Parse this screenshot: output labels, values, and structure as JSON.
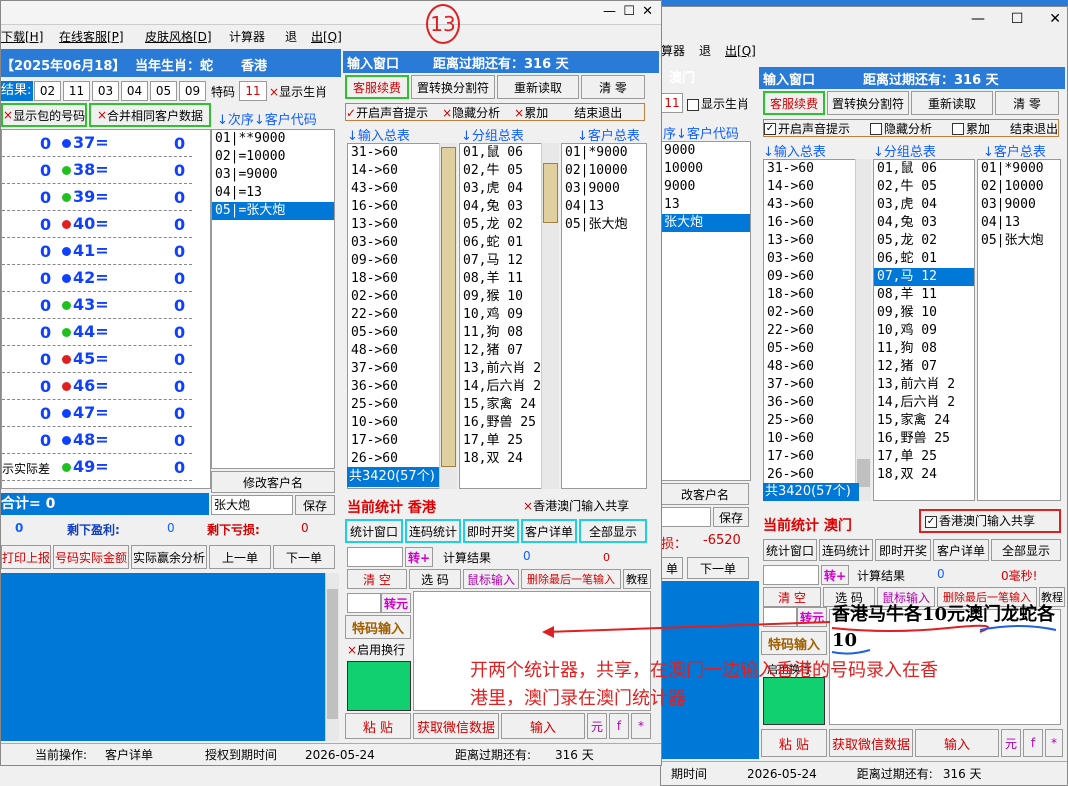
{
  "annotation": {
    "number": "13",
    "note_line1": "开两个统计器，共享，在澳门一边输入香港的号码录入在香",
    "note_line2": "港里，澳门录在澳门统计器",
    "handwritten": "香港马牛各10元澳门龙蛇各10"
  },
  "front": {
    "menu": [
      "下载[H]",
      "在线客服[P]",
      "皮肤风格[D]",
      "计算器",
      "退",
      "出[Q]"
    ],
    "date": "【2025年06月18】",
    "year_zodiac": "当年生肖：蛇",
    "region": "香港",
    "result_label": "结果:",
    "result_nums": [
      "02",
      "11",
      "03",
      "04",
      "05",
      "09"
    ],
    "special_label": "特码",
    "special": "11",
    "show_zodiac": "显示生肖",
    "show_pack": "显示包的号码",
    "merge_label": "合并相同客户数据",
    "left_rows": [
      {
        "a": "0",
        "n": "37=",
        "b": "0",
        "c": "#1040ff"
      },
      {
        "a": "0",
        "n": "38=",
        "b": "0",
        "c": "#20c020"
      },
      {
        "a": "0",
        "n": "39=",
        "b": "0",
        "c": "#20c020"
      },
      {
        "a": "0",
        "n": "40=",
        "b": "0",
        "c": "#e02020"
      },
      {
        "a": "0",
        "n": "41=",
        "b": "0",
        "c": "#1040ff"
      },
      {
        "a": "0",
        "n": "42=",
        "b": "0",
        "c": "#1040ff"
      },
      {
        "a": "0",
        "n": "43=",
        "b": "0",
        "c": "#20c020"
      },
      {
        "a": "0",
        "n": "44=",
        "b": "0",
        "c": "#20c020"
      },
      {
        "a": "0",
        "n": "45=",
        "b": "0",
        "c": "#e02020"
      },
      {
        "a": "0",
        "n": "46=",
        "b": "0",
        "c": "#e02020"
      },
      {
        "a": "0",
        "n": "47=",
        "b": "0",
        "c": "#1040ff"
      },
      {
        "a": "0",
        "n": "48=",
        "b": "0",
        "c": "#1040ff"
      }
    ],
    "last_row_label": "示实际差",
    "last_row_n": "49=",
    "last_row_b": "0",
    "order_hdr": "↓次序↓客户代码",
    "customers": [
      "01|**9000",
      "02|=10000",
      "03|=9000",
      "04|=13",
      "05|=张大炮"
    ],
    "edit_name": "修改客户名",
    "name_value": "张大炮",
    "save": "保存",
    "total": "合计= 0",
    "remaining_profit_label": "剩下盈利:",
    "remaining_profit": "0",
    "remaining_loss_label": "剩下亏损:",
    "remaining_loss": "0",
    "left_zero": "0",
    "btns": [
      "打印上报",
      "号码实际金额",
      "实际赢余分析",
      "上一单",
      "下一单"
    ],
    "input_window": "输入窗口",
    "expire": "距离过期还有：316 天",
    "top_btns": [
      "客服续费",
      "置转换分割符",
      "重新读取",
      "清 零"
    ],
    "checks": [
      "开启声音提示",
      "隐藏分析",
      "累加",
      "结束退出"
    ],
    "col_hdrs": [
      "↓输入总表",
      "↓分组总表",
      "↓客户总表"
    ],
    "input_list": [
      "31->60",
      "14->60",
      "43->60",
      "16->60",
      "13->60",
      "03->60",
      "09->60",
      "18->60",
      "02->60",
      "22->60",
      "05->60",
      "48->60",
      "37->60",
      "36->60",
      "25->60",
      "10->60",
      "17->60",
      "26->60"
    ],
    "input_total": "共3420(57个)",
    "group_list": [
      "01,鼠 06",
      "02,牛 05",
      "03,虎 04",
      "04,兔 03",
      "05,龙 02",
      "06,蛇 01",
      "07,马 12",
      "08,羊 11",
      "09,猴 10",
      "10,鸡 09",
      "11,狗 08",
      "12,猪 07",
      "13,前六肖 2",
      "14,后六肖 2",
      "15,家禽 24",
      "16,野兽 25",
      "17,单 25",
      "18,双 24"
    ],
    "cust_list": [
      "01|*9000",
      "02|10000",
      "03|9000",
      "04|13",
      "05|张大炮"
    ],
    "cur_stat": "当前统计 香港",
    "share": "香港澳门输入共享",
    "stat_btns": [
      "统计窗口",
      "连码统计",
      "即时开奖",
      "客户详单",
      "全部显示"
    ],
    "zhuan": "转+",
    "calc_result": "计算结果",
    "calc_a": "0",
    "calc_b": "0",
    "clear_row": [
      "清 空",
      "选 码",
      "鼠标输入",
      "删除最后一笔输入",
      "教程"
    ],
    "zhuanyuan": "转元",
    "special_input": "特码输入",
    "wrap": "启用换行",
    "bottom_btns": [
      "粘 贴",
      "获取微信数据",
      "输入",
      "元",
      "f",
      "*"
    ],
    "status": {
      "op_label": "当前操作:",
      "op": "客户详单",
      "auth": "授权到期时间",
      "date": "2026-05-24",
      "expire_label": "距离过期还有:",
      "days": "316 天"
    }
  },
  "back": {
    "menu": [
      "算器",
      "退",
      "出[Q]"
    ],
    "region": "澳门",
    "special": "11",
    "show_zodiac": "显示生肖",
    "order_hdr": "序↓客户代码",
    "customers": [
      "9000",
      "10000",
      "9000",
      "13",
      "张大炮"
    ],
    "edit_name": "改客户名",
    "save": "保存",
    "loss": "损：",
    "loss_val": "-6520",
    "next": "下一单",
    "btn_prev": "单",
    "input_window": "输入窗口",
    "expire": "距离过期还有：316 天",
    "top_btns": [
      "客服续费",
      "置转换分割符",
      "重新读取",
      "清 零"
    ],
    "checks": [
      "开启声音提示",
      "隐藏分析",
      "累加",
      "结束退出"
    ],
    "col_hdrs": [
      "↓输入总表",
      "↓分组总表",
      "↓客户总表"
    ],
    "input_list": [
      "31->60",
      "14->60",
      "43->60",
      "16->60",
      "13->60",
      "03->60",
      "09->60",
      "18->60",
      "02->60",
      "22->60",
      "05->60",
      "48->60",
      "37->60",
      "36->60",
      "25->60",
      "10->60",
      "17->60",
      "26->60"
    ],
    "input_total": "共3420(57个)",
    "group_list": [
      "01,鼠 06",
      "02,牛 05",
      "03,虎 04",
      "04,兔 03",
      "05,龙 02",
      "06,蛇 01",
      "07,马 12",
      "08,羊 11",
      "09,猴 10",
      "10,鸡 09",
      "11,狗 08",
      "12,猪 07",
      "13,前六肖 2",
      "14,后六肖 2",
      "15,家禽 24",
      "16,野兽 25",
      "17,单 25",
      "18,双 24"
    ],
    "cust_list": [
      "01|*9000",
      "02|10000",
      "03|9000",
      "04|13",
      "05|张大炮"
    ],
    "cur_stat": "当前统计 澳门",
    "share": "香港澳门输入共享",
    "stat_btns": [
      "统计窗口",
      "连码统计",
      "即时开奖",
      "客户详单",
      "全部显示"
    ],
    "zhuan": "转+",
    "calc_result": "计算结果",
    "calc_a": "0",
    "ms": "0毫秒!",
    "clear_row": [
      "清 空",
      "选 码",
      "鼠标输入",
      "删除最后一笔输入",
      "教程"
    ],
    "zhuanyuan": "转元",
    "special_input": "特码输入",
    "wrap": "启用换行",
    "bottom_btns": [
      "粘 贴",
      "获取微信数据",
      "输入",
      "元",
      "f",
      "*"
    ],
    "status": {
      "auth": "期时间",
      "date": "2026-05-24",
      "expire_label": "距离过期还有:",
      "days": "316 天"
    }
  }
}
